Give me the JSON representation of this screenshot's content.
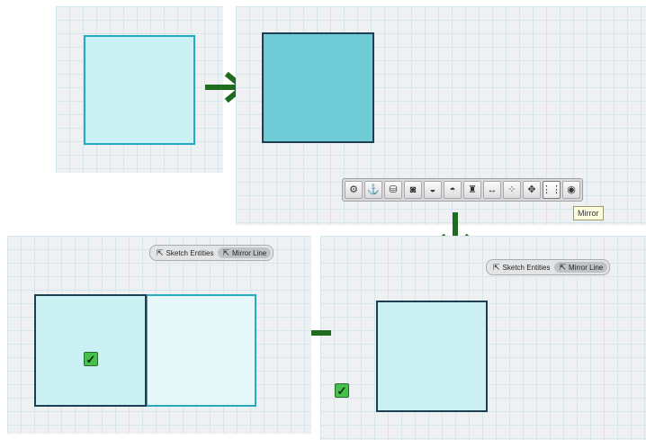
{
  "colors": {
    "arrow": "#1f6b1f",
    "shape_fill_light": "#ccf1f4",
    "shape_fill_selected": "#6fcbd6",
    "shape_border_light": "#27aabf",
    "shape_border_dark": "#1d3f52",
    "confirm_green": "#45c04a"
  },
  "toolbar": {
    "buttons": [
      {
        "icon": "gear-icon",
        "glyph": "⚙"
      },
      {
        "icon": "anchor-icon",
        "glyph": "⚓"
      },
      {
        "icon": "paint-bucket-icon",
        "glyph": "⛁"
      },
      {
        "icon": "extrude-icon",
        "glyph": "◙"
      },
      {
        "icon": "revolve-icon",
        "glyph": "◒"
      },
      {
        "icon": "sweep-icon",
        "glyph": "◓"
      },
      {
        "icon": "loft-icon",
        "glyph": "♜"
      },
      {
        "icon": "dimension-icon",
        "glyph": "↔"
      },
      {
        "icon": "pattern-icon",
        "glyph": "⁘"
      },
      {
        "icon": "move-icon",
        "glyph": "✥"
      },
      {
        "icon": "mirror-icon",
        "glyph": "⋮⋮"
      },
      {
        "icon": "eye-icon",
        "glyph": "◉"
      }
    ],
    "tooltip": "Mirror"
  },
  "mirror_selector_right": {
    "sketch_entities_label": "Sketch Entities",
    "mirror_line_label": "Mirror Line",
    "selected": "mirror_line"
  },
  "mirror_selector_left": {
    "sketch_entities_label": "Sketch Entities",
    "mirror_line_label": "Mirror Line",
    "selected": "mirror_line"
  },
  "confirm_glyph": "✓"
}
